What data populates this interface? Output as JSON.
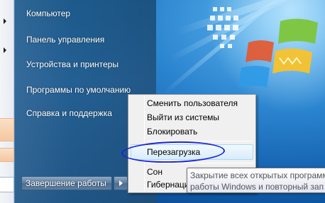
{
  "start_menu": {
    "items": [
      {
        "label": "Компьютер",
        "has_submenu": true
      },
      {
        "label": "Панель управления",
        "has_submenu": true
      },
      {
        "label": "Устройства и принтеры",
        "has_submenu": false
      },
      {
        "label": "Программы по умолчанию",
        "has_submenu": false
      },
      {
        "label": "Справка и поддержка",
        "has_submenu": false
      }
    ],
    "shutdown_label": "Завершение работы"
  },
  "shutdown_submenu": {
    "items": [
      {
        "label": "Сменить пользователя"
      },
      {
        "label": "Выйти из системы"
      },
      {
        "label": "Блокировать"
      },
      {
        "label": "Перезагрузка",
        "highlighted": true
      },
      {
        "label": "Сон"
      },
      {
        "label": "Гибернация"
      }
    ]
  },
  "tooltip": {
    "line1": "Закрытие всех открытых программ",
    "line2": "работы Windows и повторный зап"
  },
  "colors": {
    "menu_panel": "#245f93",
    "annotation_oval": "#1c24d8"
  }
}
